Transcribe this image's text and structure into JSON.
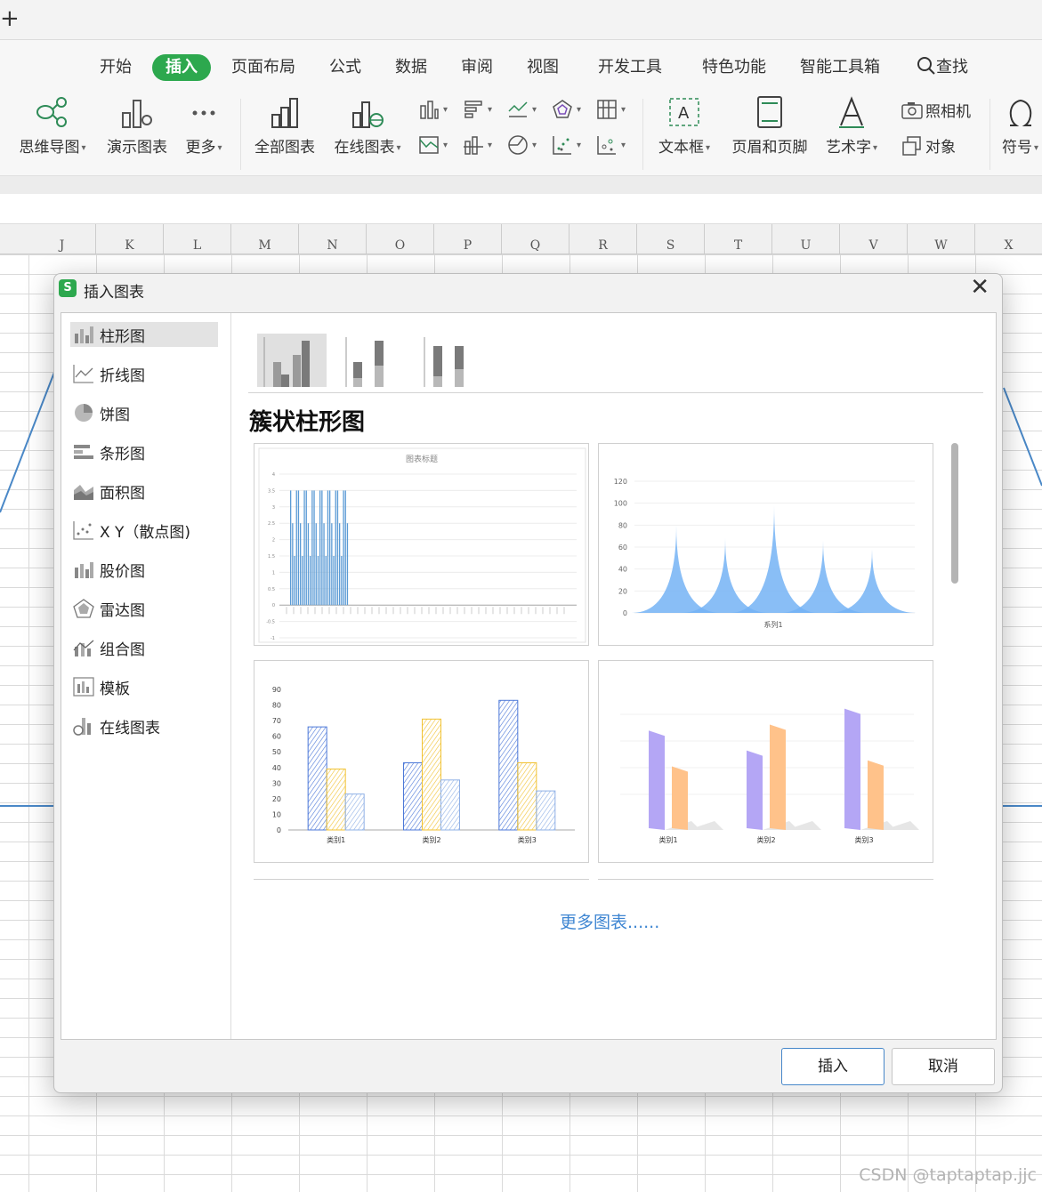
{
  "window": {
    "new_tab_glyph": "+"
  },
  "ribbon_tabs": [
    {
      "label": "开始",
      "active": false
    },
    {
      "label": "插入",
      "active": true
    },
    {
      "label": "页面布局",
      "active": false
    },
    {
      "label": "公式",
      "active": false
    },
    {
      "label": "数据",
      "active": false
    },
    {
      "label": "审阅",
      "active": false
    },
    {
      "label": "视图",
      "active": false
    },
    {
      "label": "开发工具",
      "active": false
    },
    {
      "label": "特色功能",
      "active": false
    },
    {
      "label": "智能工具箱",
      "active": false
    },
    {
      "label": "查找",
      "active": false
    }
  ],
  "toolbar": {
    "mindmap": "思维导图",
    "demo_chart": "演示图表",
    "more": "更多",
    "all_charts": "全部图表",
    "online_charts": "在线图表",
    "textbox": "文本框",
    "header_footer": "页眉和页脚",
    "wordart": "艺术字",
    "camera": "照相机",
    "object": "对象",
    "symbol": "符号"
  },
  "columns": [
    "J",
    "K",
    "L",
    "M",
    "N",
    "O",
    "P",
    "Q",
    "R",
    "S",
    "T",
    "U",
    "V",
    "W",
    "X"
  ],
  "dialog": {
    "title": "插入图表",
    "icon_glyph": "S",
    "close_glyph": "✕",
    "nav": [
      {
        "label": "柱形图",
        "icon": "column-chart-icon"
      },
      {
        "label": "折线图",
        "icon": "line-chart-icon"
      },
      {
        "label": "饼图",
        "icon": "pie-chart-icon"
      },
      {
        "label": "条形图",
        "icon": "bar-chart-icon"
      },
      {
        "label": "面积图",
        "icon": "area-chart-icon"
      },
      {
        "label": "X Y（散点图)",
        "icon": "scatter-chart-icon"
      },
      {
        "label": "股价图",
        "icon": "stock-chart-icon"
      },
      {
        "label": "雷达图",
        "icon": "radar-chart-icon"
      },
      {
        "label": "组合图",
        "icon": "combo-chart-icon"
      },
      {
        "label": "模板",
        "icon": "template-icon"
      },
      {
        "label": "在线图表",
        "icon": "online-chart-icon"
      }
    ],
    "section_title": "簇状柱形图",
    "more_link": "更多图表......",
    "insert_button": "插入",
    "cancel_button": "取消"
  },
  "chart_data": [
    {
      "type": "bar",
      "title": "图表标题",
      "ylim": [
        -1,
        4
      ],
      "yticks": [
        "4",
        "3.5",
        "3",
        "2.5",
        "2",
        "1.5",
        "1",
        "0.5",
        "0",
        "-0.5",
        "-1"
      ]
    },
    {
      "type": "area",
      "series": [
        {
          "name": "系列1",
          "peaks": [
            80,
            68,
            98,
            66,
            58
          ]
        }
      ],
      "ylim": [
        0,
        120
      ],
      "yticks": [
        "120",
        "100",
        "80",
        "60",
        "40",
        "20",
        "0"
      ]
    },
    {
      "type": "bar",
      "categories": [
        "类别1",
        "类别2",
        "类别3"
      ],
      "series": [
        {
          "values": [
            66,
            43,
            83
          ],
          "color": "#4c78d8"
        },
        {
          "values": [
            39,
            71,
            43
          ],
          "color": "#f1c232"
        },
        {
          "values": [
            23,
            32,
            25
          ],
          "color": "#8fb0e6"
        }
      ],
      "ylim": [
        0,
        90
      ],
      "yticks": [
        "90",
        "80",
        "70",
        "60",
        "50",
        "40",
        "30",
        "20",
        "10",
        "0"
      ]
    },
    {
      "type": "bar",
      "categories": [
        "类别1",
        "类别2",
        "类别3"
      ],
      "series": [
        {
          "values": [
            100,
            80,
            122
          ],
          "color": "#b4a6f5"
        },
        {
          "values": [
            64,
            106,
            70
          ],
          "color": "#ffc28a"
        }
      ]
    }
  ],
  "watermark": "CSDN @taptaptap.jjc"
}
